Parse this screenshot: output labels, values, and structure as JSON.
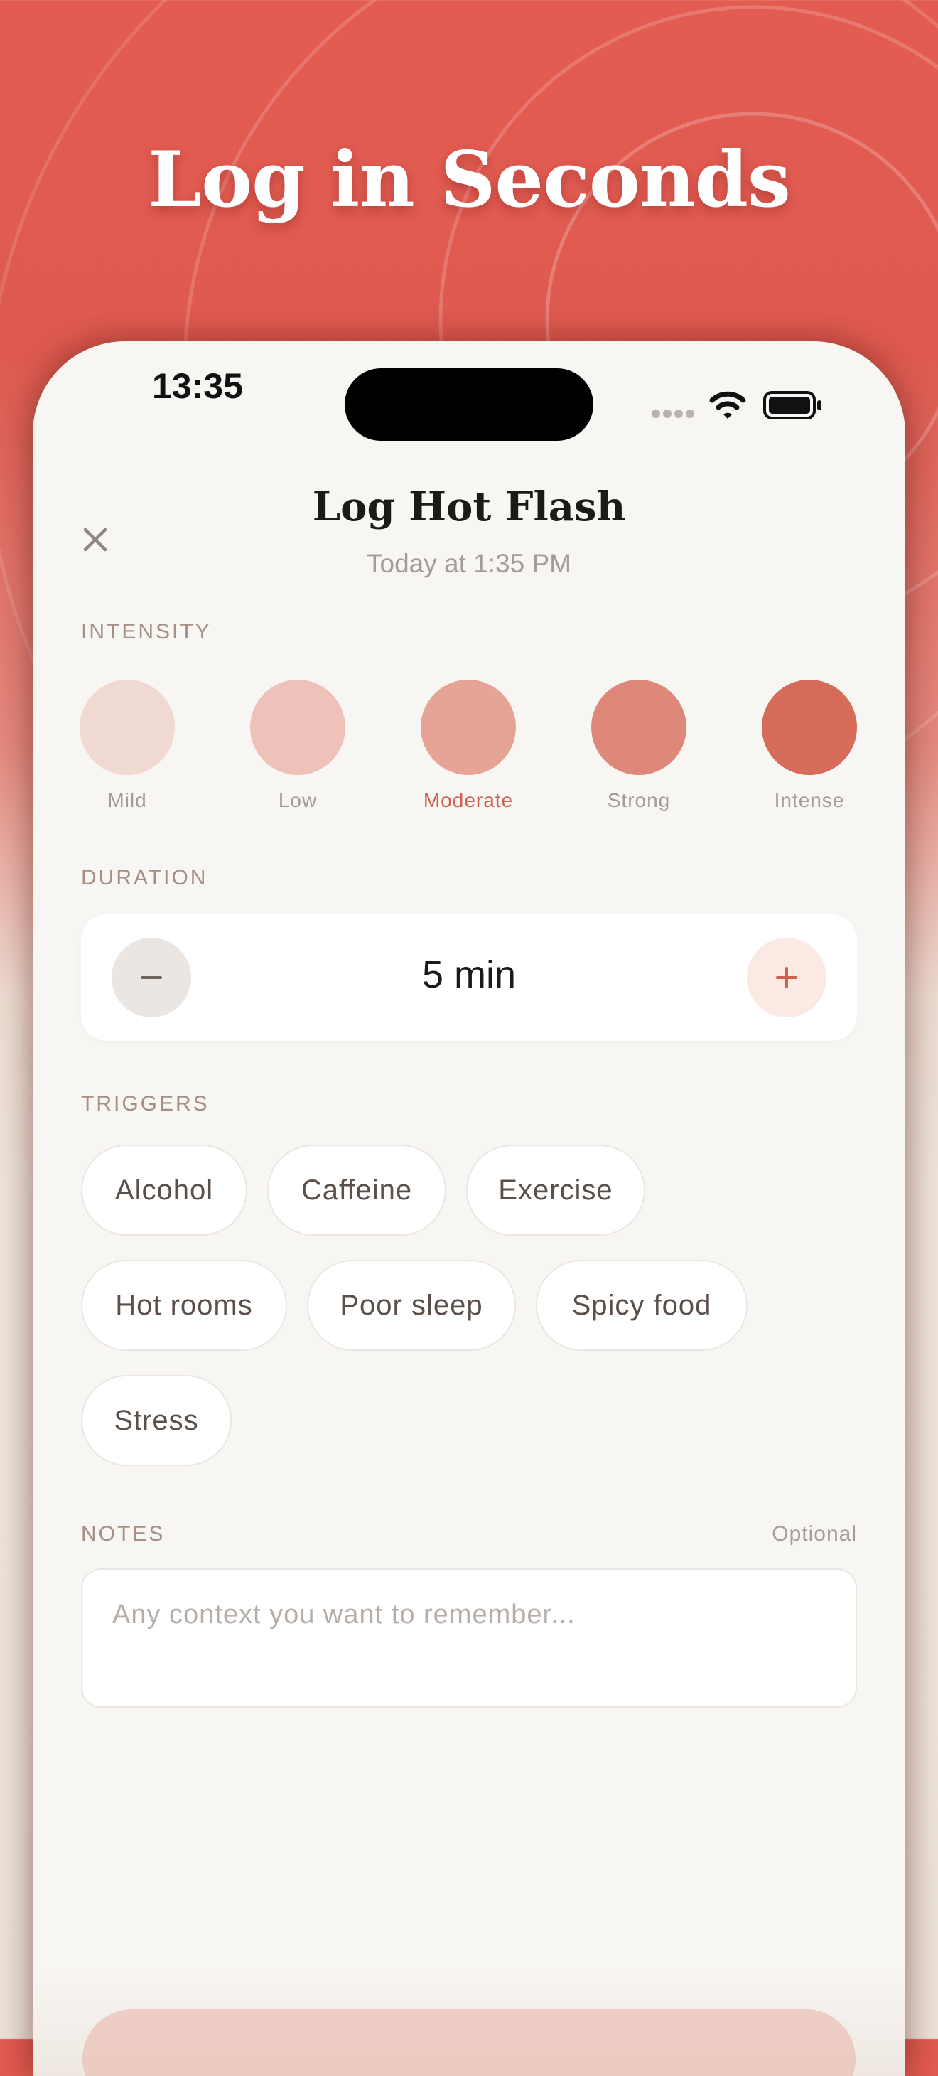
{
  "headline": "Log in Seconds",
  "status_bar": {
    "time": "13:35"
  },
  "sheet": {
    "title": "Log Hot Flash",
    "subtitle": "Today at 1:35 PM",
    "close_icon": "close-icon"
  },
  "intensity": {
    "label": "INTENSITY",
    "selected": "Moderate",
    "levels": [
      {
        "label": "Mild",
        "color": "#f1d9d3"
      },
      {
        "label": "Low",
        "color": "#eec2b9"
      },
      {
        "label": "Moderate",
        "color": "#e6a497"
      },
      {
        "label": "Strong",
        "color": "#de887a"
      },
      {
        "label": "Intense",
        "color": "#d56b58"
      }
    ]
  },
  "duration": {
    "label": "DURATION",
    "value": "5 min",
    "decrement_symbol": "−",
    "increment_symbol": "+"
  },
  "triggers": {
    "label": "TRIGGERS",
    "items": [
      "Alcohol",
      "Caffeine",
      "Exercise",
      "Hot rooms",
      "Poor sleep",
      "Spicy food",
      "Stress"
    ]
  },
  "notes": {
    "label": "NOTES",
    "optional_label": "Optional",
    "value": "",
    "placeholder": "Any context you want to remember..."
  },
  "colors": {
    "accent": "#d2604f",
    "background_red": "#e35c52",
    "sheet_background": "#f8f6f3"
  }
}
